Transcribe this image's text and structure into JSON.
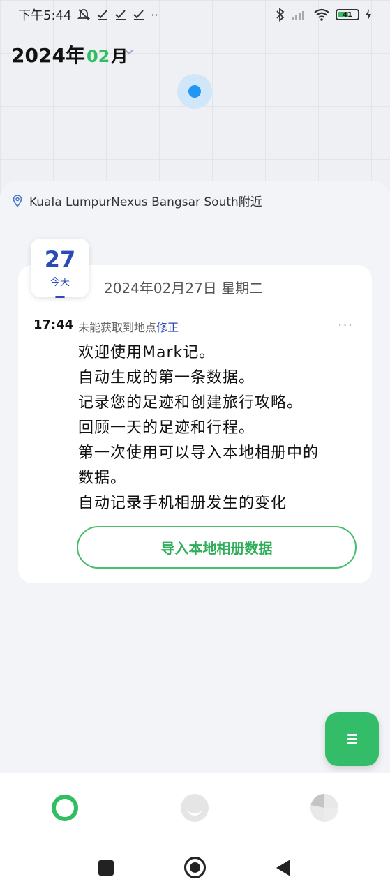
{
  "status_bar": {
    "time": "下午5:44",
    "left_icons": [
      "mute-bell-icon",
      "check-icon",
      "check-icon",
      "check-icon",
      "more-dots-icon"
    ],
    "right_icons": [
      "bluetooth-icon",
      "signal-icon",
      "wifi-icon",
      "battery-icon",
      "charging-icon"
    ],
    "battery_level": "41"
  },
  "header": {
    "year": "2024年",
    "month": "02",
    "month_unit": "月"
  },
  "location": {
    "text": "Kuala LumpurNexus Bangsar South附近"
  },
  "date_badge": {
    "day": "27",
    "label": "今天"
  },
  "card": {
    "date_text": "2024年02月27日 星期二",
    "entry": {
      "time": "17:44",
      "location_status": "未能获取到地点",
      "fix_label": "修正",
      "more": "···",
      "lines": [
        "欢迎使用Mark记。",
        "自动生成的第一条数据。",
        "记录您的足迹和创建旅行攻略。",
        "回顾一天的足迹和行程。",
        "第一次使用可以导入本地相册中的",
        "数据。",
        "自动记录手机相册发生的变化"
      ]
    },
    "import_button": "导入本地相册数据"
  },
  "colors": {
    "accent_green": "#2fbf62",
    "date_blue": "#2a4bb5",
    "location_blue": "#2196f3"
  },
  "bottom_nav": {
    "items": [
      "home-ring-icon",
      "face-icon",
      "pie-chart-icon"
    ],
    "active_index": 0
  }
}
